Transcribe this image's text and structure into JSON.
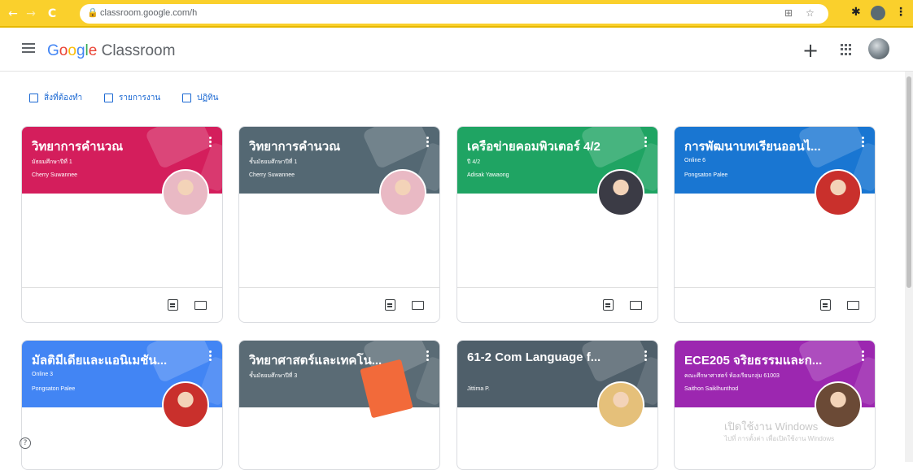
{
  "browser": {
    "back_icon": "arrow-left-icon",
    "forward_icon": "arrow-right-icon",
    "reload_icon": "reload-icon",
    "url": "classroom.google.com/h",
    "star_icon": "star-icon",
    "accent": "#fad02c"
  },
  "header": {
    "logo_google": [
      "G",
      "o",
      "o",
      "g",
      "l",
      "e"
    ],
    "logo_product": "Classroom",
    "menu_icon": "hamburger-menu-icon",
    "plus_label": "+",
    "apps_icon": "apps-grid-icon"
  },
  "quick_links": [
    {
      "label": "สิ่งที่ต้องทำ",
      "icon": "todo-icon"
    },
    {
      "label": "รายการงาน",
      "icon": "folder-icon"
    },
    {
      "label": "ปฏิทิน",
      "icon": "calendar-icon"
    }
  ],
  "courses": [
    {
      "title": "วิทยาการคำนวณ",
      "subtitle": "มัธยมศึกษาปีที่ 1",
      "teacher": "Cherry Suwannee",
      "color": "#d41e5c",
      "avatar": "#e9b9c4"
    },
    {
      "title": "วิทยาการคำนวณ",
      "subtitle": "ชั้นมัธยมศึกษาปีที่ 1",
      "teacher": "Cherry Suwannee",
      "color": "#546873",
      "avatar": "#e9b9c4"
    },
    {
      "title": "เครือข่ายคอมพิวเตอร์ 4/2",
      "subtitle": "ปี 4/2",
      "teacher": "Adisak Yawaong",
      "color": "#1fa463",
      "avatar": "#3b3b45"
    },
    {
      "title": "การพัฒนาบทเรียนออนไ...",
      "subtitle": "Online 6",
      "teacher": "Pongsaton Palee",
      "color": "#1976d2",
      "avatar": "#c9302c"
    },
    {
      "title": "มัลติมีเดียและแอนิเมชัน...",
      "subtitle": "Online 3",
      "teacher": "Pongsaton Palee",
      "color": "#4285f4",
      "avatar": "#c9302c"
    },
    {
      "title": "วิทยาศาสตร์และเทคโน...",
      "subtitle": "ชั้นมัธยมศึกษาปีที่ 3",
      "teacher": "",
      "color": "#5a6b75",
      "avatar": null
    },
    {
      "title": "61-2 Com Language f...",
      "subtitle": "",
      "teacher": "Jittima P.",
      "color": "#4f5f6a",
      "avatar": "#e5c07a"
    },
    {
      "title": "ECE205 จริยธรรมและก...",
      "subtitle": "คณะศึกษาศาสตร์ ห้องเรียนกลุ่ม 61003",
      "teacher": "Saithon Saiklhunthod",
      "color": "#9c27b0",
      "avatar": "#6b4a36"
    }
  ],
  "watermark": {
    "line1": "เปิดใช้งาน Windows",
    "line2": "ไปที่ การตั้งค่า เพื่อเปิดใช้งาน Windows"
  },
  "help_label": "?"
}
